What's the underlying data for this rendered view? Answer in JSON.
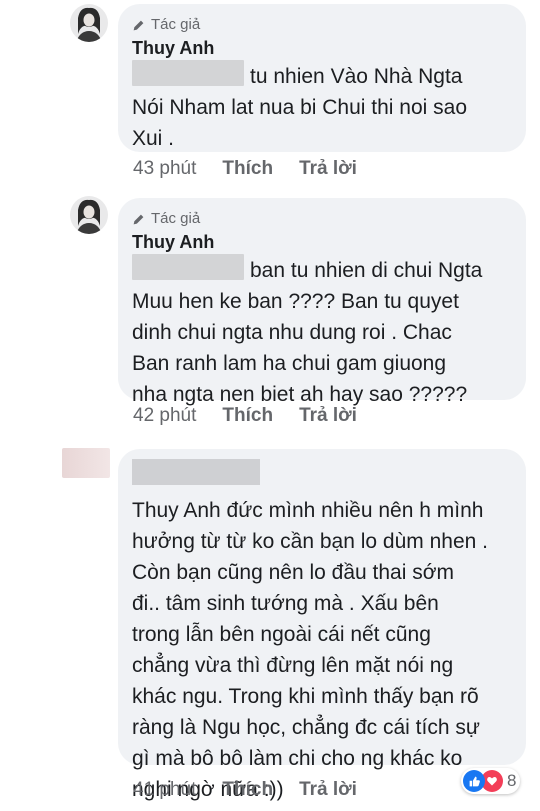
{
  "comments": [
    {
      "author_tag": "Tác giả",
      "author": "Thuy Anh",
      "first_line": "tu nhien Vào Nhà Ngta",
      "lines": [
        "Nói Nham lat nua bi Chui thi noi sao",
        "Xui ."
      ],
      "time": "43 phút",
      "like_label": "Thích",
      "reply_label": "Trả lời"
    },
    {
      "author_tag": "Tác giả",
      "author": "Thuy Anh",
      "first_line": "ban tu nhien di chui Ngta",
      "lines": [
        "Muu hen ke ban ???? Ban tu quyet",
        "dinh chui ngta nhu dung roi . Chac",
        "Ban ranh lam ha chui gam giuong",
        "nha ngta nen biet ah hay sao ?????"
      ],
      "time": "42 phút",
      "like_label": "Thích",
      "reply_label": "Trả lời"
    },
    {
      "lines": [
        "Thuy Anh đức mình nhiều nên h mình",
        "hưởng từ từ ko cần bạn lo dùm nhen .",
        "Còn bạn cũng nên lo đầu thai sớm",
        "đi.. tâm sinh tướng mà . Xấu bên",
        "trong lẫn bên ngoài cái nết cũng",
        "chẳng vừa thì đừng lên mặt nói ng",
        "khác ngu. Trong khi mình thấy bạn rõ",
        "ràng là Ngu học, chẳng đc cái tích sự",
        "gì mà bô bô làm chi cho ng khác ko",
        "nghi ngờ nữa :))"
      ],
      "time": "41 phút",
      "like_label": "Thích",
      "reply_label": "Trả lời",
      "reaction_count": "8",
      "reaction_icons": [
        "like-icon",
        "love-icon"
      ]
    }
  ]
}
